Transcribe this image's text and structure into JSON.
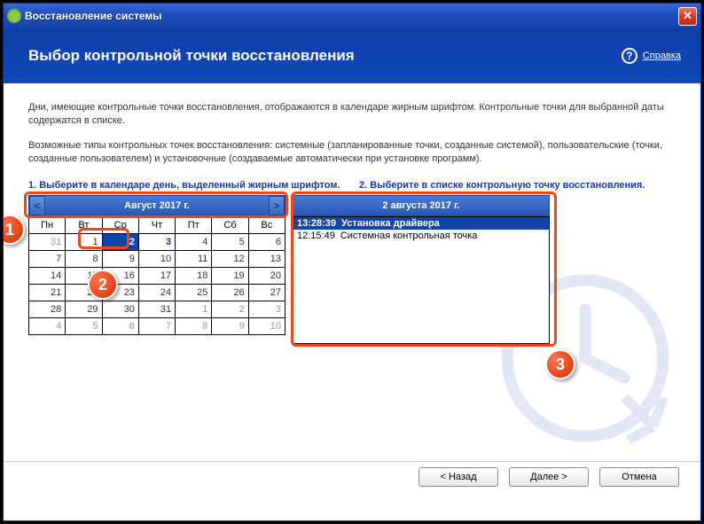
{
  "window": {
    "title": "Восстановление системы"
  },
  "header": {
    "title": "Выбор контрольной точки восстановления"
  },
  "help": {
    "label": "Справка"
  },
  "intro": {
    "p1": "Дни, имеющие контрольные точки восстановления, отображаются в календаре жирным шрифтом. Контрольные точки для выбранной даты содержатся в списке.",
    "p2": "Возможные типы контрольных точек восстановления: системные (запланированные точки, созданные системой), пользовательские (точки, созданные пользователем) и установочные (создаваемые автоматически при установке программ)."
  },
  "step1": {
    "label": "1. Выберите в календаре день, выделенный жирным шрифтом."
  },
  "step2": {
    "label": "2. Выберите в списке контрольную точку восстановления."
  },
  "calendar": {
    "month": "Август 2017 г.",
    "prev": "<",
    "next": ">",
    "days": [
      "Пн",
      "Вт",
      "Ср",
      "Чт",
      "Пт",
      "Сб",
      "Вс"
    ],
    "rows": [
      [
        {
          "v": "31",
          "o": true
        },
        {
          "v": "1"
        },
        {
          "v": "2",
          "sel": true,
          "b": true
        },
        {
          "v": "3",
          "b": true
        },
        {
          "v": "4"
        },
        {
          "v": "5"
        },
        {
          "v": "6"
        }
      ],
      [
        {
          "v": "7"
        },
        {
          "v": "8"
        },
        {
          "v": "9"
        },
        {
          "v": "10"
        },
        {
          "v": "11"
        },
        {
          "v": "12"
        },
        {
          "v": "13"
        }
      ],
      [
        {
          "v": "14"
        },
        {
          "v": "15"
        },
        {
          "v": "16"
        },
        {
          "v": "17"
        },
        {
          "v": "18"
        },
        {
          "v": "19"
        },
        {
          "v": "20"
        }
      ],
      [
        {
          "v": "21"
        },
        {
          "v": "22"
        },
        {
          "v": "23"
        },
        {
          "v": "24"
        },
        {
          "v": "25"
        },
        {
          "v": "26"
        },
        {
          "v": "27"
        }
      ],
      [
        {
          "v": "28"
        },
        {
          "v": "29"
        },
        {
          "v": "30"
        },
        {
          "v": "31"
        },
        {
          "v": "1",
          "o": true
        },
        {
          "v": "2",
          "o": true
        },
        {
          "v": "3",
          "o": true
        }
      ],
      [
        {
          "v": "4",
          "o": true
        },
        {
          "v": "5",
          "o": true
        },
        {
          "v": "6",
          "o": true
        },
        {
          "v": "7",
          "o": true
        },
        {
          "v": "8",
          "o": true
        },
        {
          "v": "9",
          "o": true
        },
        {
          "v": "10",
          "o": true
        }
      ]
    ]
  },
  "list": {
    "date": "2 августа 2017 г.",
    "items": [
      {
        "time": "13:28:39",
        "label": "Установка драйвера",
        "sel": true
      },
      {
        "time": "12:15:49",
        "label": "Системная контрольная точка",
        "sel": false
      }
    ]
  },
  "buttons": {
    "back": "< Назад",
    "next": "Далее >",
    "cancel": "Отмена"
  },
  "annotations": {
    "a1": "1",
    "a2": "2",
    "a3": "3"
  }
}
